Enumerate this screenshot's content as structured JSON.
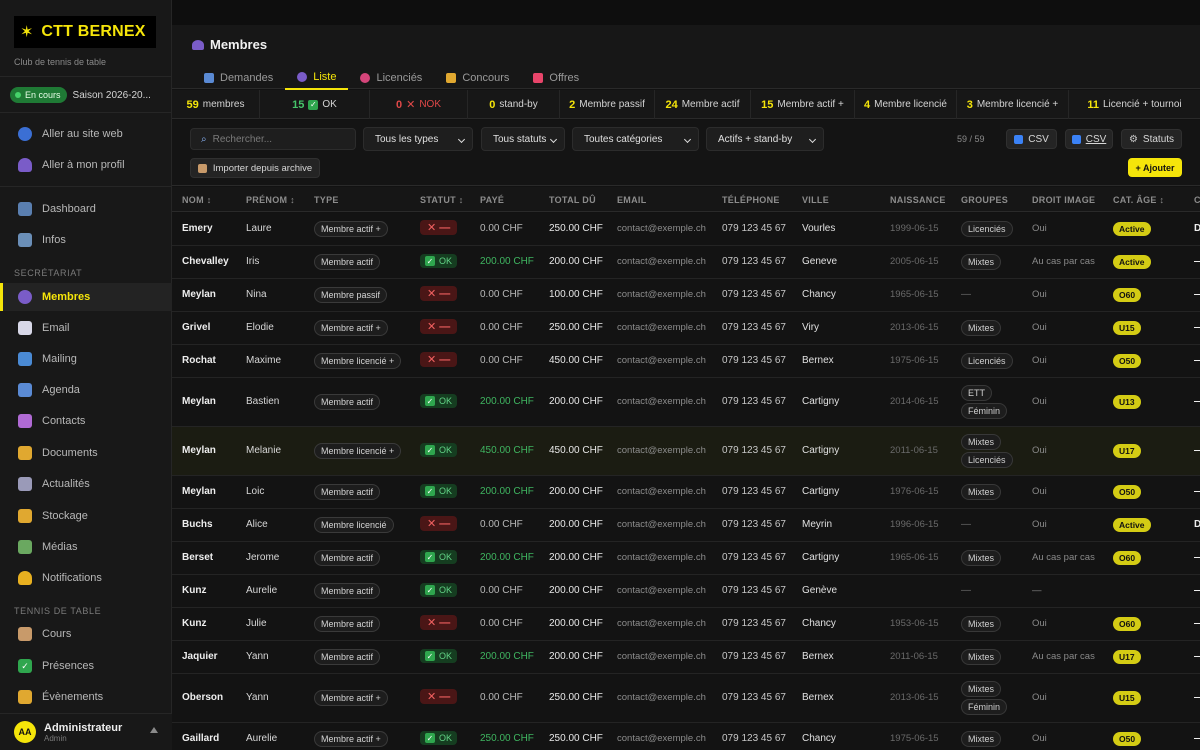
{
  "app": {
    "name": "CTT BERNEX",
    "subtitle": "Club de tennis de table"
  },
  "season": {
    "status": "En cours",
    "label": "Saison 2026-20..."
  },
  "sidebar": {
    "quick": [
      {
        "label": "Aller au site web",
        "icon": "globe-icon"
      },
      {
        "label": "Aller à mon profil",
        "icon": "user-icon"
      }
    ],
    "top": [
      {
        "label": "Dashboard",
        "icon": "dashboard-icon"
      },
      {
        "label": "Infos",
        "icon": "building-icon"
      }
    ],
    "section_secretariat": "SECRÉTARIAT",
    "secretariat": [
      {
        "label": "Membres",
        "icon": "members-icon",
        "active": true
      },
      {
        "label": "Email",
        "icon": "email-icon"
      },
      {
        "label": "Mailing",
        "icon": "mailing-icon"
      },
      {
        "label": "Agenda",
        "icon": "calendar-icon"
      },
      {
        "label": "Contacts",
        "icon": "contacts-icon"
      },
      {
        "label": "Documents",
        "icon": "folder-icon"
      },
      {
        "label": "Actualités",
        "icon": "news-icon"
      },
      {
        "label": "Stockage",
        "icon": "storage-icon"
      },
      {
        "label": "Médias",
        "icon": "image-icon"
      },
      {
        "label": "Notifications",
        "icon": "bell-icon"
      }
    ],
    "section_tennis": "TENNIS DE TABLE",
    "tennis": [
      {
        "label": "Cours",
        "icon": "clipboard-icon"
      },
      {
        "label": "Présences",
        "icon": "check-icon"
      },
      {
        "label": "Évènements",
        "icon": "trophy-icon"
      }
    ],
    "user": {
      "initials": "AA",
      "name": "Administrateur",
      "role": "Admin"
    }
  },
  "page": {
    "title": "Membres",
    "tabs": [
      {
        "label": "Demandes",
        "icon": "inbox-icon"
      },
      {
        "label": "Liste",
        "icon": "members-icon",
        "active": true
      },
      {
        "label": "Licenciés",
        "icon": "paddle-icon"
      },
      {
        "label": "Concours",
        "icon": "trophy-icon"
      },
      {
        "label": "Offres",
        "icon": "ticket-icon"
      }
    ]
  },
  "stats": {
    "membres": {
      "value": "59",
      "label": "membres"
    },
    "ok": {
      "value": "15",
      "label": "OK"
    },
    "nok": {
      "value": "0",
      "label": "NOK"
    },
    "standby": {
      "value": "0",
      "label": "stand-by"
    },
    "passif": {
      "value": "2",
      "label": "Membre passif"
    },
    "actif": {
      "value": "24",
      "label": "Membre actif"
    },
    "actif_plus": {
      "value": "15",
      "label": "Membre actif +"
    },
    "licencie": {
      "value": "4",
      "label": "Membre licencié"
    },
    "licencie_plus": {
      "value": "3",
      "label": "Membre licencié +"
    },
    "tournoi": {
      "value": "11",
      "label": "Licencié + tournoi"
    }
  },
  "filters": {
    "search_placeholder": "Rechercher...",
    "type": "Tous les types",
    "statut": "Tous statuts",
    "categorie": "Toutes catégories",
    "actifs": "Actifs + stand-by",
    "count": "59 / 59",
    "csv_export": "CSV",
    "csv_import": "CSV",
    "statuts": "Statuts",
    "import_archive": "Importer depuis archive",
    "add": "+ Ajouter"
  },
  "table": {
    "headers": {
      "nom": "NOM ↕",
      "prenom": "PRÉNOM ↕",
      "type": "TYPE",
      "statut": "STATUT ↕",
      "paye": "PAYÉ",
      "total": "TOTAL DÛ",
      "email": "EMAIL",
      "tel": "TÉLÉPHONE",
      "ville": "VILLE",
      "naissance": "NAISSANCE",
      "groupes": "GROUPES",
      "droit": "DROIT IMAGE",
      "cat": "CAT. ÂGE ↕",
      "edge": "C"
    },
    "status_ok": "OK",
    "status_nok": "✕ —",
    "rows": [
      {
        "nom": "Emery",
        "prenom": "Laure",
        "type": "Membre actif +",
        "ok": false,
        "paye": "0.00 CHF",
        "total": "250.00 CHF",
        "email": "contact@exemple.ch",
        "tel": "079 123 45 67",
        "ville": "Vourles",
        "naissance": "1999-06-15",
        "groupes": [
          "Licenciés"
        ],
        "droit": "Oui",
        "cat": "Active",
        "edge": "D"
      },
      {
        "nom": "Chevalley",
        "prenom": "Iris",
        "type": "Membre actif",
        "ok": true,
        "paye": "200.00 CHF",
        "total": "200.00 CHF",
        "email": "contact@exemple.ch",
        "tel": "079 123 45 67",
        "ville": "Geneve",
        "naissance": "2005-06-15",
        "groupes": [
          "Mixtes"
        ],
        "droit": "Au cas par cas",
        "cat": "Active",
        "edge": "—"
      },
      {
        "nom": "Meylan",
        "prenom": "Nina",
        "type": "Membre passif",
        "ok": false,
        "paye": "0.00 CHF",
        "total": "100.00 CHF",
        "email": "contact@exemple.ch",
        "tel": "079 123 45 67",
        "ville": "Chancy",
        "naissance": "1965-06-15",
        "groupes": [],
        "droit": "Oui",
        "cat": "O60",
        "edge": "—"
      },
      {
        "nom": "Grivel",
        "prenom": "Elodie",
        "type": "Membre actif +",
        "ok": false,
        "paye": "0.00 CHF",
        "total": "250.00 CHF",
        "email": "contact@exemple.ch",
        "tel": "079 123 45 67",
        "ville": "Viry",
        "naissance": "2013-06-15",
        "groupes": [
          "Mixtes"
        ],
        "droit": "Oui",
        "cat": "U15",
        "edge": "—"
      },
      {
        "nom": "Rochat",
        "prenom": "Maxime",
        "type": "Membre licencié +",
        "ok": false,
        "paye": "0.00 CHF",
        "total": "450.00 CHF",
        "email": "contact@exemple.ch",
        "tel": "079 123 45 67",
        "ville": "Bernex",
        "naissance": "1975-06-15",
        "groupes": [
          "Licenciés"
        ],
        "droit": "Oui",
        "cat": "O50",
        "edge": "—"
      },
      {
        "nom": "Meylan",
        "prenom": "Bastien",
        "type": "Membre actif",
        "ok": true,
        "paye": "200.00 CHF",
        "total": "200.00 CHF",
        "email": "contact@exemple.ch",
        "tel": "079 123 45 67",
        "ville": "Cartigny",
        "naissance": "2014-06-15",
        "groupes": [
          "ETT",
          "Féminin"
        ],
        "droit": "Oui",
        "cat": "U13",
        "edge": "—"
      },
      {
        "nom": "Meylan",
        "prenom": "Melanie",
        "type": "Membre licencié +",
        "ok": true,
        "paye": "450.00 CHF",
        "total": "450.00 CHF",
        "email": "contact@exemple.ch",
        "tel": "079 123 45 67",
        "ville": "Cartigny",
        "naissance": "2011-06-15",
        "groupes": [
          "Mixtes",
          "Licenciés"
        ],
        "droit": "Oui",
        "cat": "U17",
        "edge": "—",
        "highlight": true
      },
      {
        "nom": "Meylan",
        "prenom": "Loic",
        "type": "Membre actif",
        "ok": true,
        "paye": "200.00 CHF",
        "total": "200.00 CHF",
        "email": "contact@exemple.ch",
        "tel": "079 123 45 67",
        "ville": "Cartigny",
        "naissance": "1976-06-15",
        "groupes": [
          "Mixtes"
        ],
        "droit": "Oui",
        "cat": "O50",
        "edge": "—"
      },
      {
        "nom": "Buchs",
        "prenom": "Alice",
        "type": "Membre licencié",
        "ok": false,
        "paye": "0.00 CHF",
        "total": "200.00 CHF",
        "email": "contact@exemple.ch",
        "tel": "079 123 45 67",
        "ville": "Meyrin",
        "naissance": "1996-06-15",
        "groupes": [],
        "droit": "Oui",
        "cat": "Active",
        "edge": "D"
      },
      {
        "nom": "Berset",
        "prenom": "Jerome",
        "type": "Membre actif",
        "ok": true,
        "paye": "200.00 CHF",
        "total": "200.00 CHF",
        "email": "contact@exemple.ch",
        "tel": "079 123 45 67",
        "ville": "Cartigny",
        "naissance": "1965-06-15",
        "groupes": [
          "Mixtes"
        ],
        "droit": "Au cas par cas",
        "cat": "O60",
        "edge": "—"
      },
      {
        "nom": "Kunz",
        "prenom": "Aurelie",
        "type": "Membre actif",
        "ok": true,
        "paye": "0.00 CHF",
        "total": "200.00 CHF",
        "email": "contact@exemple.ch",
        "tel": "079 123 45 67",
        "ville": "Genève",
        "naissance": "",
        "groupes": [],
        "droit": "—",
        "cat": "",
        "edge": "—"
      },
      {
        "nom": "Kunz",
        "prenom": "Julie",
        "type": "Membre actif",
        "ok": false,
        "paye": "0.00 CHF",
        "total": "200.00 CHF",
        "email": "contact@exemple.ch",
        "tel": "079 123 45 67",
        "ville": "Chancy",
        "naissance": "1953-06-15",
        "groupes": [
          "Mixtes"
        ],
        "droit": "Oui",
        "cat": "O60",
        "edge": "—"
      },
      {
        "nom": "Jaquier",
        "prenom": "Yann",
        "type": "Membre actif",
        "ok": true,
        "paye": "200.00 CHF",
        "total": "200.00 CHF",
        "email": "contact@exemple.ch",
        "tel": "079 123 45 67",
        "ville": "Bernex",
        "naissance": "2011-06-15",
        "groupes": [
          "Mixtes"
        ],
        "droit": "Au cas par cas",
        "cat": "U17",
        "edge": "—"
      },
      {
        "nom": "Oberson",
        "prenom": "Yann",
        "type": "Membre actif +",
        "ok": false,
        "paye": "0.00 CHF",
        "total": "250.00 CHF",
        "email": "contact@exemple.ch",
        "tel": "079 123 45 67",
        "ville": "Bernex",
        "naissance": "2013-06-15",
        "groupes": [
          "Mixtes",
          "Féminin"
        ],
        "droit": "Oui",
        "cat": "U15",
        "edge": "—"
      },
      {
        "nom": "Gaillard",
        "prenom": "Aurelie",
        "type": "Membre actif +",
        "ok": true,
        "paye": "250.00 CHF",
        "total": "250.00 CHF",
        "email": "contact@exemple.ch",
        "tel": "079 123 45 67",
        "ville": "Chancy",
        "naissance": "1975-06-15",
        "groupes": [
          "Mixtes"
        ],
        "droit": "Oui",
        "cat": "O50",
        "edge": "—"
      }
    ]
  }
}
